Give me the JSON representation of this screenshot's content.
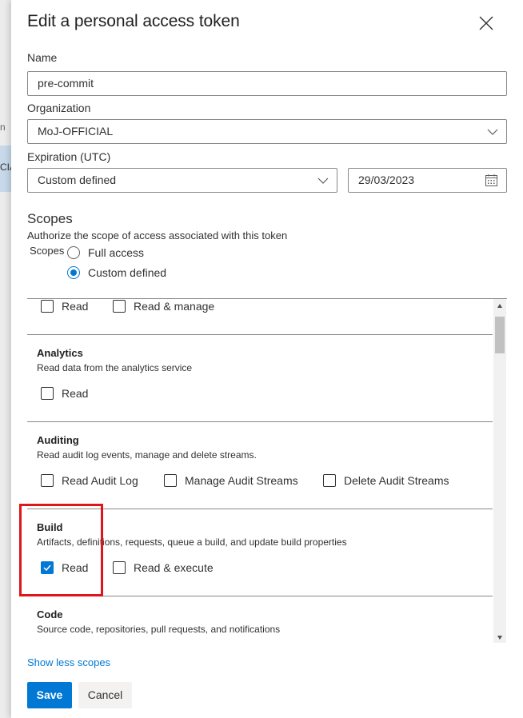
{
  "background": {
    "fragment_top": "n",
    "fragment_selected": "CIA"
  },
  "dialog": {
    "title": "Edit a personal access token",
    "close_icon": "close-icon"
  },
  "form": {
    "name": {
      "label": "Name",
      "value": "pre-commit"
    },
    "organization": {
      "label": "Organization",
      "value": "MoJ-OFFICIAL"
    },
    "expiration": {
      "label": "Expiration (UTC)",
      "value": "Custom defined",
      "date": "29/03/2023"
    }
  },
  "scopes": {
    "heading": "Scopes",
    "subtitle": "Authorize the scope of access associated with this token",
    "group_label": "Scopes",
    "options": [
      {
        "label": "Full access",
        "selected": false
      },
      {
        "label": "Custom defined",
        "selected": true
      }
    ],
    "top_row": [
      {
        "label": "Read",
        "checked": false
      },
      {
        "label": "Read & manage",
        "checked": false
      }
    ],
    "sections": [
      {
        "title": "Analytics",
        "description": "Read data from the analytics service",
        "options": [
          {
            "label": "Read",
            "checked": false
          }
        ]
      },
      {
        "title": "Auditing",
        "description": "Read audit log events, manage and delete streams.",
        "options": [
          {
            "label": "Read Audit Log",
            "checked": false
          },
          {
            "label": "Manage Audit Streams",
            "checked": false
          },
          {
            "label": "Delete Audit Streams",
            "checked": false
          }
        ]
      },
      {
        "title": "Build",
        "description": "Artifacts, definitions, requests, queue a build, and update build properties",
        "options": [
          {
            "label": "Read",
            "checked": true
          },
          {
            "label": "Read & execute",
            "checked": false
          }
        ]
      },
      {
        "title": "Code",
        "description": "Source code, repositories, pull requests, and notifications",
        "options": []
      }
    ]
  },
  "footer": {
    "toggle_link": "Show less scopes",
    "save": "Save",
    "cancel": "Cancel"
  },
  "colors": {
    "accent": "#0078d4",
    "highlight": "#e0141b"
  }
}
